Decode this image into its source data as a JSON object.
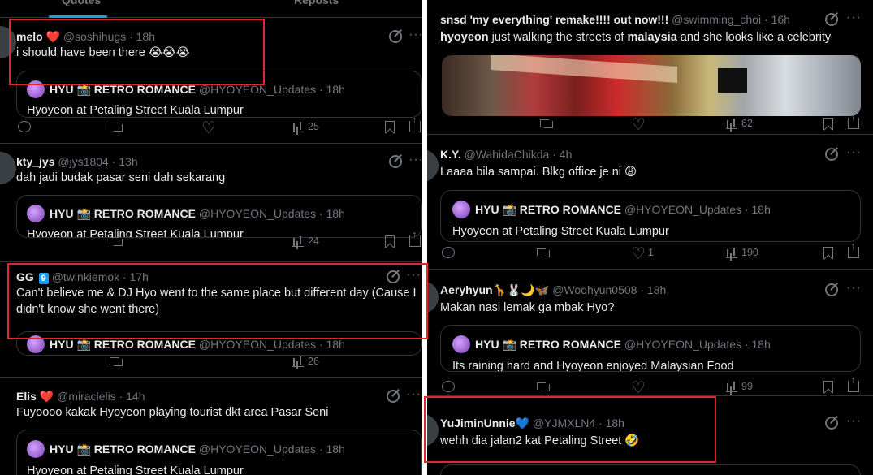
{
  "left": {
    "tabs": [
      "Quotes",
      "Reposts"
    ],
    "posts": [
      {
        "name": "melo",
        "badge_emoji": "❤️",
        "handle": "@soshihugs",
        "sep": "·",
        "time": "18h",
        "text": "i should have been there 😭😭😭",
        "quote": {
          "name": "HYU 📸 RETRO ROMANCE",
          "handle": "@HYOYEON_Updates",
          "sep": "·",
          "time": "18h",
          "text": "Hyoyeon at Petaling Street Kuala Lumpur"
        },
        "views": "25"
      },
      {
        "name": "kty_jys",
        "handle": "@jys1804",
        "sep": "·",
        "time": "13h",
        "text": "dah jadi budak pasar seni dah sekarang",
        "quote": {
          "name": "HYU 📸 RETRO ROMANCE",
          "handle": "@HYOYEON_Updates",
          "sep": "·",
          "time": "18h",
          "text": "Hyoyeon at Petaling Street Kuala Lumpur"
        },
        "views": "24"
      },
      {
        "name": "GG",
        "badge": "9",
        "handle": "@twinkiemok",
        "sep": "·",
        "time": "17h",
        "text": "Can't believe me & DJ Hyo went to the same place but different day (Cause I didn't know she went there)",
        "quote": {
          "name": "HYU 📸 RETRO ROMANCE",
          "handle": "@HYOYEON_Updates",
          "sep": "·",
          "time": "18h"
        },
        "views": "26"
      },
      {
        "name": "Elis",
        "badge_emoji": "❤️",
        "handle": "@miraclelis",
        "sep": "·",
        "time": "14h",
        "text": "Fuyoooo kakak Hyoyeon playing tourist dkt area Pasar Seni",
        "quote": {
          "name": "HYU 📸 RETRO ROMANCE",
          "handle": "@HYOYEON_Updates",
          "sep": "·",
          "time": "18h",
          "text": "Hyoyeon at Petaling Street Kuala Lumpur"
        }
      }
    ]
  },
  "right": {
    "posts": [
      {
        "name": "snsd 'my everything' remake!!!! out now!!!",
        "handle": "@swimming_choi",
        "sep": "·",
        "time": "16h",
        "text_pre": "hyoyeon",
        "text_mid": " just walking the streets of ",
        "text_bold": "malaysia",
        "text_post": " and she looks like a celebrity",
        "views": "62"
      },
      {
        "name": "K.Y.",
        "handle": "@WahidaChikda",
        "sep": "·",
        "time": "4h",
        "text": "Laaaa bila sampai. Blkg office je ni 😩",
        "quote": {
          "name": "HYU 📸 RETRO ROMANCE",
          "handle": "@HYOYEON_Updates",
          "sep": "·",
          "time": "18h",
          "text": "Hyoyeon at Petaling Street Kuala Lumpur"
        },
        "likes": "1",
        "views": "190"
      },
      {
        "name": "Aeryhyun🦒🐰🌙🦋",
        "handle": "@Woohyun0508",
        "sep": "·",
        "time": "18h",
        "text": "Makan nasi lemak ga mbak Hyo?",
        "quote": {
          "name": "HYU 📸 RETRO ROMANCE",
          "handle": "@HYOYEON_Updates",
          "sep": "·",
          "time": "18h",
          "text": "Its raining hard and Hyoyeon enjoyed Malaysian Food"
        },
        "views": "99"
      },
      {
        "name": "YuJiminUnnie💙",
        "handle": "@YJMXLN4",
        "sep": "·",
        "time": "18h",
        "text": "wehh dia jalan2 kat Petaling Street 🤣"
      }
    ]
  },
  "colors": {
    "background": "#000000",
    "text": "#e7e9ea",
    "muted": "#71767b",
    "divider": "#2f3336",
    "highlight_box": "#e3262b"
  }
}
